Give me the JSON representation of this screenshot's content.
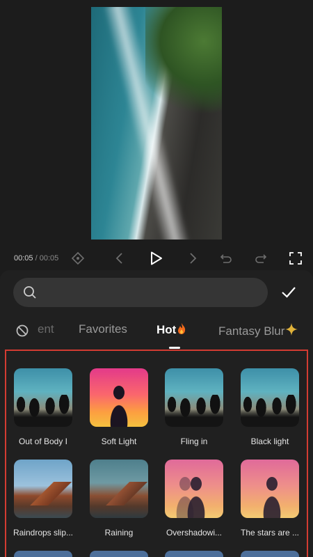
{
  "player": {
    "current_time": "00:05",
    "separator": "/",
    "total_time": "00:05"
  },
  "search": {
    "value": "",
    "placeholder": ""
  },
  "tabs": [
    {
      "label": "ent",
      "icon": "no-entry-icon"
    },
    {
      "label": "Favorites"
    },
    {
      "label": "Hot",
      "icon": "fire-icon",
      "active": true
    },
    {
      "label": "Fantasy Blur",
      "icon": "sparkle-icon"
    }
  ],
  "effects": [
    {
      "label": "Out of Body I"
    },
    {
      "label": "Soft Light"
    },
    {
      "label": "Fling in"
    },
    {
      "label": "Black light"
    },
    {
      "label": "Raindrops slip..."
    },
    {
      "label": "Raining"
    },
    {
      "label": "Overshadowi..."
    },
    {
      "label": "The stars are ..."
    }
  ],
  "colors": {
    "selection_border": "#d33b32",
    "panel": "#202020",
    "background": "#1c1c1c"
  }
}
